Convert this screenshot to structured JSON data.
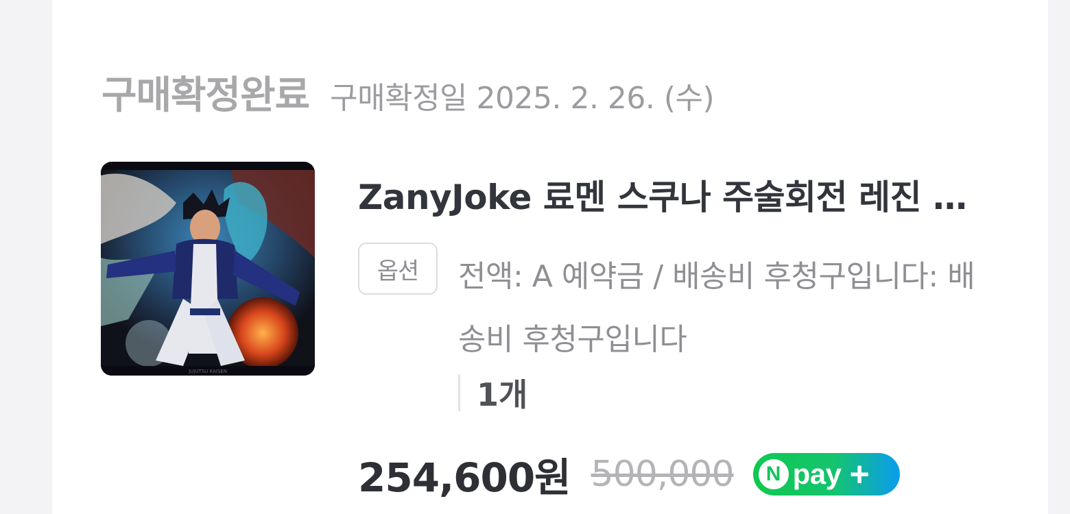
{
  "order": {
    "status": "구매확정완료",
    "confirm_date": "구매확정일 2025. 2. 26. (수)"
  },
  "product": {
    "name": "ZanyJoke 료멘 스쿠나 주술회전 레진 피규어",
    "image_icon": "product-thumbnail",
    "image_caption": "JUJUTSU KAISEN",
    "option_badge": "옵션",
    "option_text": "전액: A 예약금 / 배송비 후청구입니다: 배송비 후청구입니다",
    "quantity": "1개",
    "price": "254,600원",
    "original_price": "500,000"
  },
  "npay": {
    "letter": "N",
    "word": "pay",
    "plus": "+",
    "colors": {
      "start": "#10c850",
      "end": "#0a9cf0"
    }
  }
}
